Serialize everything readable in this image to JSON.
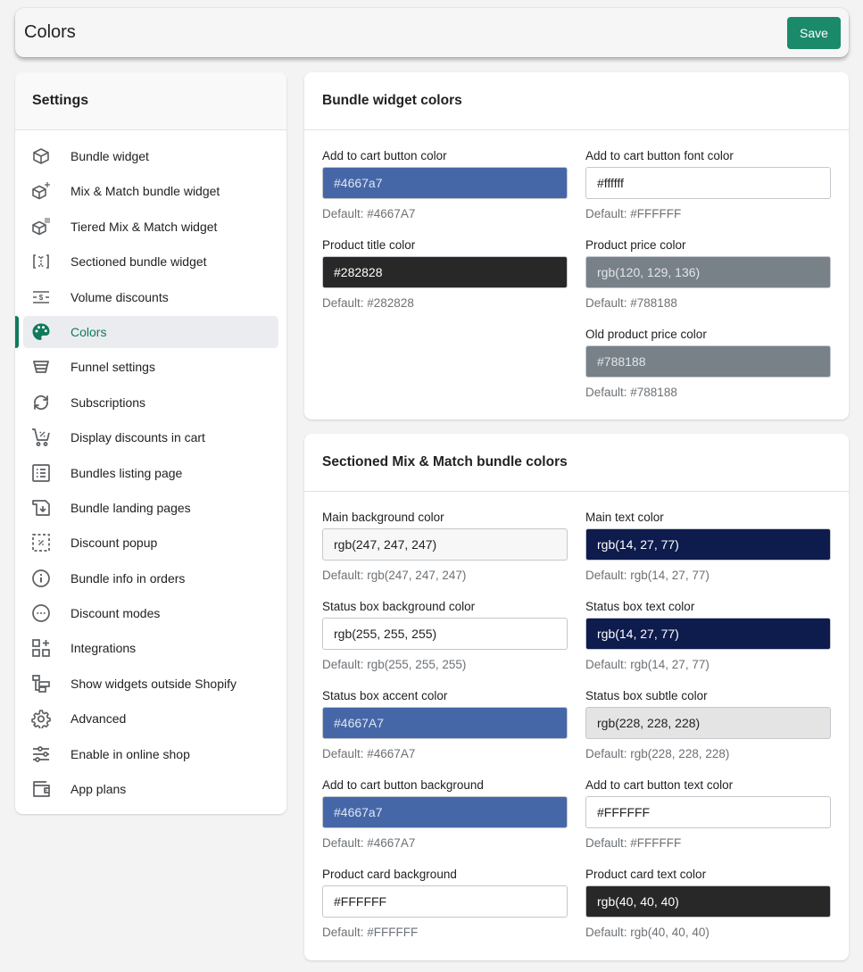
{
  "header": {
    "title": "Colors",
    "save_label": "Save"
  },
  "sidebar": {
    "title": "Settings",
    "items": [
      {
        "label": "Bundle widget",
        "icon": "box-icon",
        "active": false
      },
      {
        "label": "Mix & Match bundle widget",
        "icon": "box-plus-icon",
        "active": false
      },
      {
        "label": "Tiered Mix & Match widget",
        "icon": "box-tiers-icon",
        "active": false
      },
      {
        "label": "Sectioned bundle widget",
        "icon": "sectioned-icon",
        "active": false
      },
      {
        "label": "Volume discounts",
        "icon": "volume-discount-icon",
        "active": false
      },
      {
        "label": "Colors",
        "icon": "palette-icon",
        "active": true
      },
      {
        "label": "Funnel settings",
        "icon": "funnel-icon",
        "active": false
      },
      {
        "label": "Subscriptions",
        "icon": "refresh-icon",
        "active": false
      },
      {
        "label": "Display discounts in cart",
        "icon": "cart-discount-icon",
        "active": false
      },
      {
        "label": "Bundles listing page",
        "icon": "list-icon",
        "active": false
      },
      {
        "label": "Bundle landing pages",
        "icon": "landing-page-icon",
        "active": false
      },
      {
        "label": "Discount popup",
        "icon": "discount-popup-icon",
        "active": false
      },
      {
        "label": "Bundle info in orders",
        "icon": "info-icon",
        "active": false
      },
      {
        "label": "Discount modes",
        "icon": "more-horizontal-icon",
        "active": false
      },
      {
        "label": "Integrations",
        "icon": "apps-add-icon",
        "active": false
      },
      {
        "label": "Show widgets outside Shopify",
        "icon": "tree-icon",
        "active": false
      },
      {
        "label": "Advanced",
        "icon": "gear-icon",
        "active": false
      },
      {
        "label": "Enable in online shop",
        "icon": "sliders-icon",
        "active": false
      },
      {
        "label": "App plans",
        "icon": "wallet-icon",
        "active": false
      }
    ]
  },
  "bundle_widget_colors": {
    "title": "Bundle widget colors",
    "fields": [
      {
        "label": "Add to cart button color",
        "value": "#4667a7",
        "default": "Default: #4667A7",
        "bg": "#4667a7",
        "fg": "#dfe6f3"
      },
      {
        "label": "Add to cart button font color",
        "value": "#ffffff",
        "default": "Default: #FFFFFF",
        "bg": "#ffffff",
        "fg": "#202223"
      },
      {
        "label": "Product title color",
        "value": "#282828",
        "default": "Default: #282828",
        "bg": "#282828",
        "fg": "#ffffff"
      },
      {
        "label": "Product price color",
        "value": "rgb(120, 129, 136)",
        "default": "Default: #788188",
        "bg": "#788188",
        "fg": "#e3e6e8"
      },
      {
        "label": "Old product price color",
        "value": "#788188",
        "default": "Default: #788188",
        "bg": "#788188",
        "fg": "#e3e6e8"
      }
    ]
  },
  "sectioned_colors": {
    "title": "Sectioned Mix & Match bundle colors",
    "fields": [
      {
        "label": "Main background color",
        "value": "rgb(247, 247, 247)",
        "default": "Default: rgb(247, 247, 247)",
        "bg": "#f7f7f7",
        "fg": "#202223"
      },
      {
        "label": "Main text color",
        "value": "rgb(14, 27, 77)",
        "default": "Default: rgb(14, 27, 77)",
        "bg": "#0e1b4d",
        "fg": "#ffffff"
      },
      {
        "label": "Status box background color",
        "value": "rgb(255, 255, 255)",
        "default": "Default: rgb(255, 255, 255)",
        "bg": "#ffffff",
        "fg": "#202223"
      },
      {
        "label": "Status box text color",
        "value": "rgb(14, 27, 77)",
        "default": "Default: rgb(14, 27, 77)",
        "bg": "#0e1b4d",
        "fg": "#ffffff"
      },
      {
        "label": "Status box accent color",
        "value": "#4667A7",
        "default": "Default: #4667A7",
        "bg": "#4667a7",
        "fg": "#dfe6f3"
      },
      {
        "label": "Status box subtle color",
        "value": "rgb(228, 228, 228)",
        "default": "Default: rgb(228, 228, 228)",
        "bg": "#e4e4e4",
        "fg": "#202223"
      },
      {
        "label": "Add to cart button background",
        "value": "#4667a7",
        "default": "Default: #4667A7",
        "bg": "#4667a7",
        "fg": "#dfe6f3"
      },
      {
        "label": "Add to cart button text color",
        "value": "#FFFFFF",
        "default": "Default: #FFFFFF",
        "bg": "#ffffff",
        "fg": "#202223"
      },
      {
        "label": "Product card background",
        "value": "#FFFFFF",
        "default": "Default: #FFFFFF",
        "bg": "#ffffff",
        "fg": "#202223"
      },
      {
        "label": "Product card text color",
        "value": "rgb(40, 40, 40)",
        "default": "Default: rgb(40, 40, 40)",
        "bg": "#282828",
        "fg": "#ffffff"
      }
    ]
  },
  "colors": {
    "brand": "#1b8a6b",
    "active_nav": "#0f7a5c"
  }
}
